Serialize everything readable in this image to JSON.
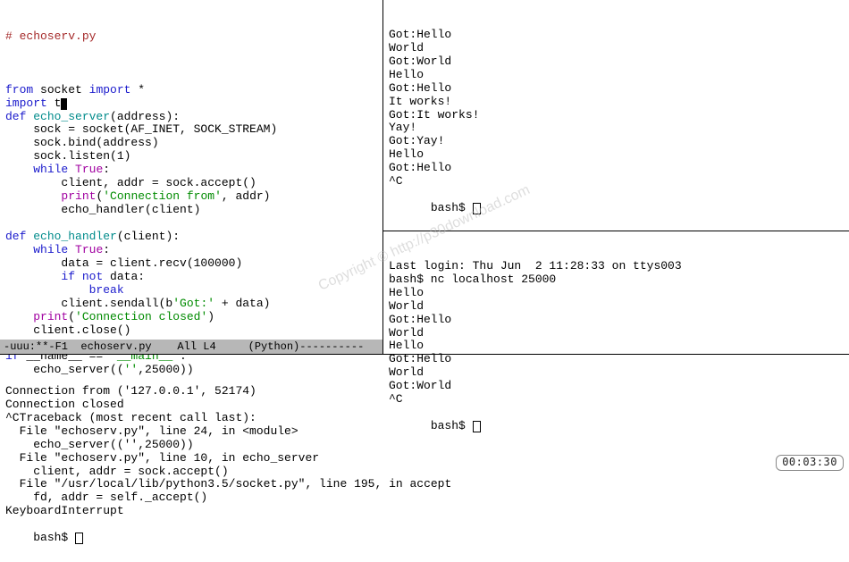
{
  "editor": {
    "comment": "# echoserv.py",
    "code_lines": [
      {
        "parts": [
          {
            "t": "",
            "cls": ""
          }
        ]
      },
      {
        "parts": [
          {
            "t": "from",
            "cls": "kw"
          },
          {
            "t": " socket ",
            "cls": ""
          },
          {
            "t": "import",
            "cls": "kw"
          },
          {
            "t": " *",
            "cls": ""
          }
        ]
      },
      {
        "parts": [
          {
            "t": "import",
            "cls": "kw"
          },
          {
            "t": " t",
            "cls": ""
          }
        ],
        "cursor": true
      },
      {
        "parts": [
          {
            "t": "def",
            "cls": "kw"
          },
          {
            "t": " ",
            "cls": ""
          },
          {
            "t": "echo_server",
            "cls": "fn"
          },
          {
            "t": "(address):",
            "cls": ""
          }
        ]
      },
      {
        "parts": [
          {
            "t": "    sock = socket(AF_INET, SOCK_STREAM)",
            "cls": ""
          }
        ]
      },
      {
        "parts": [
          {
            "t": "    sock.bind(address)",
            "cls": ""
          }
        ]
      },
      {
        "parts": [
          {
            "t": "    sock.listen(1)",
            "cls": ""
          }
        ]
      },
      {
        "parts": [
          {
            "t": "    ",
            "cls": ""
          },
          {
            "t": "while",
            "cls": "kw"
          },
          {
            "t": " ",
            "cls": ""
          },
          {
            "t": "True",
            "cls": "bi"
          },
          {
            "t": ":",
            "cls": ""
          }
        ]
      },
      {
        "parts": [
          {
            "t": "        client, addr = sock.accept()",
            "cls": ""
          }
        ]
      },
      {
        "parts": [
          {
            "t": "        ",
            "cls": ""
          },
          {
            "t": "print",
            "cls": "bi"
          },
          {
            "t": "(",
            "cls": ""
          },
          {
            "t": "'Connection from'",
            "cls": "st"
          },
          {
            "t": ", addr)",
            "cls": ""
          }
        ]
      },
      {
        "parts": [
          {
            "t": "        echo_handler(client)",
            "cls": ""
          }
        ]
      },
      {
        "parts": [
          {
            "t": "",
            "cls": ""
          }
        ]
      },
      {
        "parts": [
          {
            "t": "def",
            "cls": "kw"
          },
          {
            "t": " ",
            "cls": ""
          },
          {
            "t": "echo_handler",
            "cls": "fn"
          },
          {
            "t": "(client):",
            "cls": ""
          }
        ]
      },
      {
        "parts": [
          {
            "t": "    ",
            "cls": ""
          },
          {
            "t": "while",
            "cls": "kw"
          },
          {
            "t": " ",
            "cls": ""
          },
          {
            "t": "True",
            "cls": "bi"
          },
          {
            "t": ":",
            "cls": ""
          }
        ]
      },
      {
        "parts": [
          {
            "t": "        data = client.recv(100000)",
            "cls": ""
          }
        ]
      },
      {
        "parts": [
          {
            "t": "        ",
            "cls": ""
          },
          {
            "t": "if",
            "cls": "kw"
          },
          {
            "t": " ",
            "cls": ""
          },
          {
            "t": "not",
            "cls": "kw"
          },
          {
            "t": " data:",
            "cls": ""
          }
        ]
      },
      {
        "parts": [
          {
            "t": "            ",
            "cls": ""
          },
          {
            "t": "break",
            "cls": "kw"
          }
        ]
      },
      {
        "parts": [
          {
            "t": "        client.sendall(b",
            "cls": ""
          },
          {
            "t": "'Got:'",
            "cls": "st"
          },
          {
            "t": " + data)",
            "cls": ""
          }
        ]
      },
      {
        "parts": [
          {
            "t": "    ",
            "cls": ""
          },
          {
            "t": "print",
            "cls": "bi"
          },
          {
            "t": "(",
            "cls": ""
          },
          {
            "t": "'Connection closed'",
            "cls": "st"
          },
          {
            "t": ")",
            "cls": ""
          }
        ]
      },
      {
        "parts": [
          {
            "t": "    client.close()",
            "cls": ""
          }
        ]
      },
      {
        "parts": [
          {
            "t": "",
            "cls": ""
          }
        ]
      },
      {
        "parts": [
          {
            "t": "if",
            "cls": "kw"
          },
          {
            "t": " __name__ == ",
            "cls": ""
          },
          {
            "t": "'__main__'",
            "cls": "st"
          },
          {
            "t": ":",
            "cls": ""
          }
        ]
      },
      {
        "parts": [
          {
            "t": "    echo_server((",
            "cls": ""
          },
          {
            "t": "''",
            "cls": "st"
          },
          {
            "t": ",25000))",
            "cls": ""
          }
        ]
      }
    ],
    "statusbar": "-uuu:**-F1  echoserv.py    All L4     (Python)----------"
  },
  "term_top": {
    "lines": [
      "Got:Hello",
      "World",
      "Got:World",
      "Hello",
      "Got:Hello",
      "It works!",
      "Got:It works!",
      "Yay!",
      "Got:Yay!",
      "Hello",
      "Got:Hello",
      "^C"
    ],
    "prompt": "bash$ "
  },
  "term_mid": {
    "lines": [
      "Last login: Thu Jun  2 11:28:33 on ttys003",
      "bash$ nc localhost 25000",
      "Hello",
      "World",
      "Got:Hello",
      "World",
      "Hello",
      "Got:Hello",
      "World",
      "Got:World",
      "^C"
    ],
    "prompt": "bash$ "
  },
  "term_bot": {
    "lines": [
      "Connection from ('127.0.0.1', 52174)",
      "Connection closed",
      "^CTraceback (most recent call last):",
      "  File \"echoserv.py\", line 24, in <module>",
      "    echo_server(('',25000))",
      "  File \"echoserv.py\", line 10, in echo_server",
      "    client, addr = sock.accept()",
      "  File \"/usr/local/lib/python3.5/socket.py\", line 195, in accept",
      "    fd, addr = self._accept()",
      "KeyboardInterrupt"
    ],
    "prompt": "bash$ "
  },
  "timer": "00:03:30",
  "watermark": "Copyright © http://p30download.com"
}
